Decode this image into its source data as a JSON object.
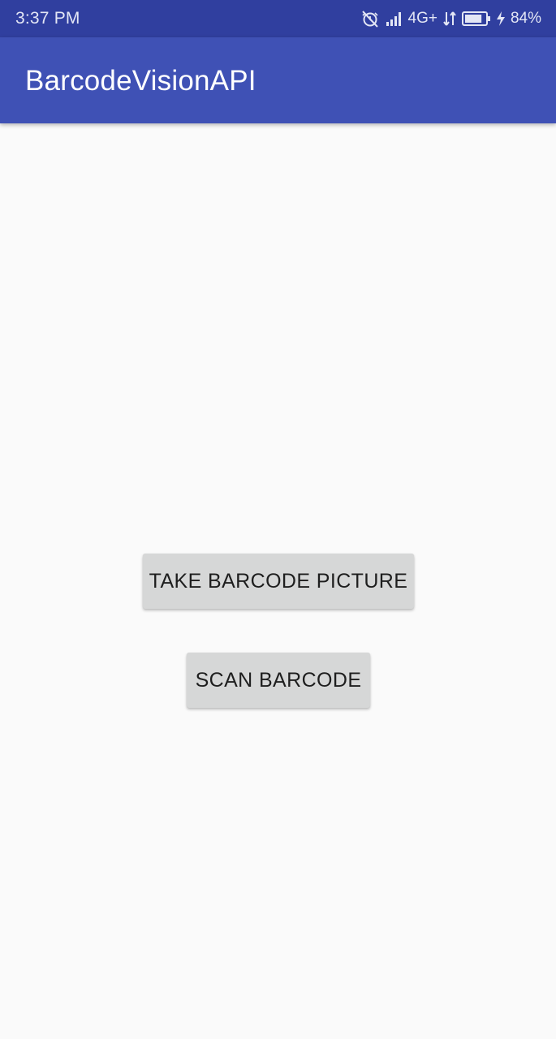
{
  "status_bar": {
    "time": "3:37 PM",
    "network_type": "4G+",
    "battery_percent": "84%",
    "battery_level": 0.84,
    "icons": [
      "alarm-off-icon",
      "signal-icon",
      "data-arrows-icon",
      "battery-icon",
      "charging-bolt-icon"
    ]
  },
  "app_bar": {
    "title": "BarcodeVisionAPI",
    "color": "#3f51b5"
  },
  "main": {
    "take_picture_label": "TAKE BARCODE PICTURE",
    "scan_label": "SCAN BARCODE"
  },
  "colors": {
    "status_bar": "#303f9f",
    "app_bar": "#3f51b5",
    "background": "#fafafa",
    "button": "#d6d7d7"
  }
}
